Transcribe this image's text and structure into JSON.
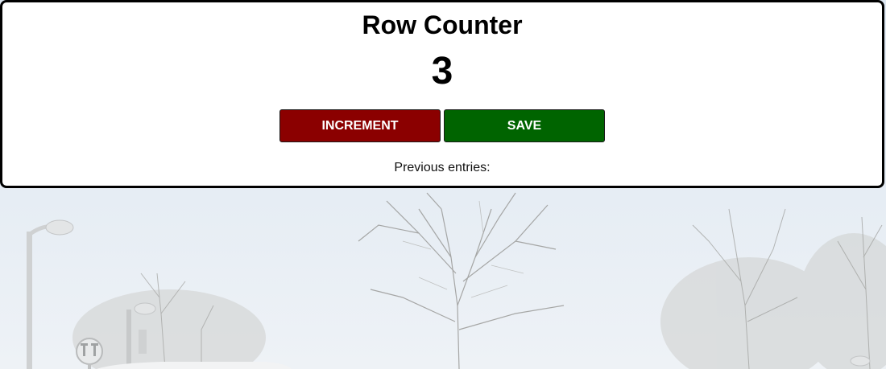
{
  "counter": {
    "title": "Row Counter",
    "value": "3",
    "increment_label": "INCREMENT",
    "save_label": "SAVE",
    "previous_label": "Previous entries:"
  },
  "colors": {
    "increment_button": "#8b0000",
    "save_button": "#006400",
    "card_border": "#000000"
  }
}
